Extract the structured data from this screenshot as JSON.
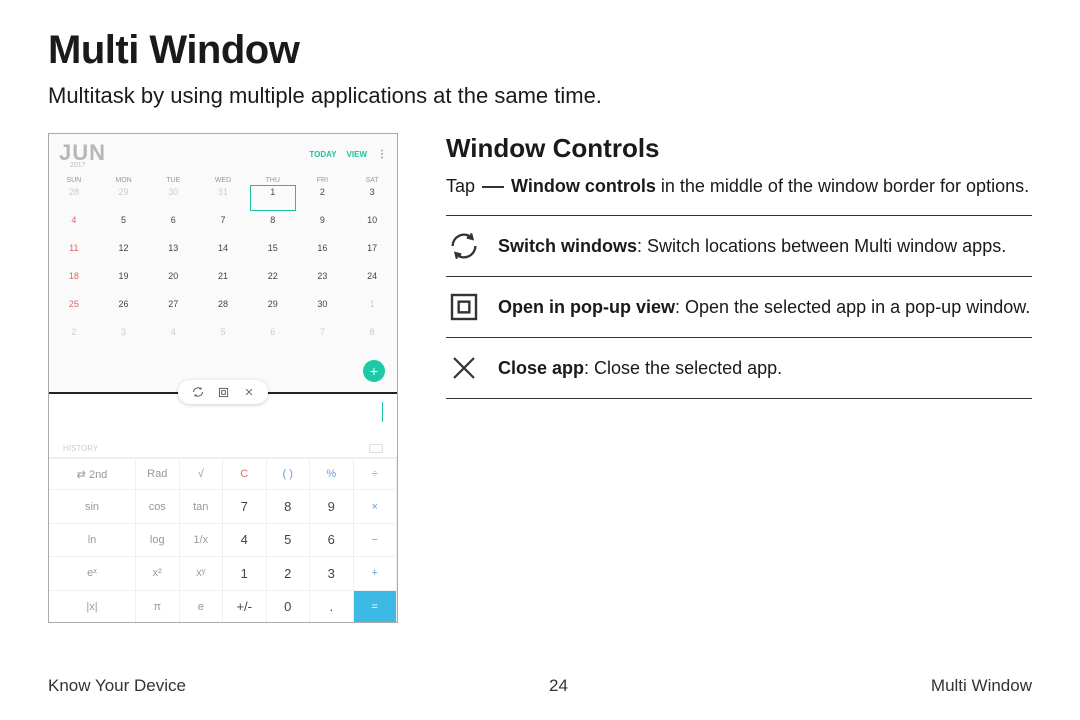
{
  "page": {
    "title": "Multi Window",
    "subtitle": "Multitask by using multiple applications at the same time."
  },
  "right": {
    "heading": "Window Controls",
    "intro_pre": "Tap ",
    "intro_bold": "Window controls",
    "intro_post": " in the middle of the window border for options.",
    "features": [
      {
        "bold": "Switch windows",
        "text": ": Switch locations between Multi window apps."
      },
      {
        "bold": "Open in pop-up view",
        "text": ": Open the selected app in a pop-up window."
      },
      {
        "bold": "Close app",
        "text": ": Close the selected app."
      }
    ]
  },
  "device": {
    "calendar": {
      "month": "JUN",
      "year": "2017",
      "today_label": "TODAY",
      "view_label": "VIEW",
      "dow": [
        "SUN",
        "MON",
        "TUE",
        "WED",
        "THU",
        "FRI",
        "SAT"
      ],
      "rows": [
        [
          "28",
          "29",
          "30",
          "31",
          "1",
          "2",
          "3"
        ],
        [
          "4",
          "5",
          "6",
          "7",
          "8",
          "9",
          "10"
        ],
        [
          "11",
          "12",
          "13",
          "14",
          "15",
          "16",
          "17"
        ],
        [
          "18",
          "19",
          "20",
          "21",
          "22",
          "23",
          "24"
        ],
        [
          "25",
          "26",
          "27",
          "28",
          "29",
          "30",
          "1"
        ],
        [
          "2",
          "3",
          "4",
          "5",
          "6",
          "7",
          "8"
        ]
      ],
      "fab": "+"
    },
    "calc": {
      "history_label": "HISTORY",
      "keys": [
        [
          "⇄ 2nd",
          "Rad",
          "√",
          "C",
          "( )",
          "%",
          "÷"
        ],
        [
          "sin",
          "cos",
          "tan",
          "7",
          "8",
          "9",
          "×"
        ],
        [
          "ln",
          "log",
          "1/x",
          "4",
          "5",
          "6",
          "−"
        ],
        [
          "eˣ",
          "x²",
          "xʸ",
          "1",
          "2",
          "3",
          "+"
        ],
        [
          "|x|",
          "π",
          "e",
          "+/-",
          "0",
          ".",
          "="
        ]
      ]
    }
  },
  "footer": {
    "left": "Know Your Device",
    "center": "24",
    "right": "Multi Window"
  }
}
